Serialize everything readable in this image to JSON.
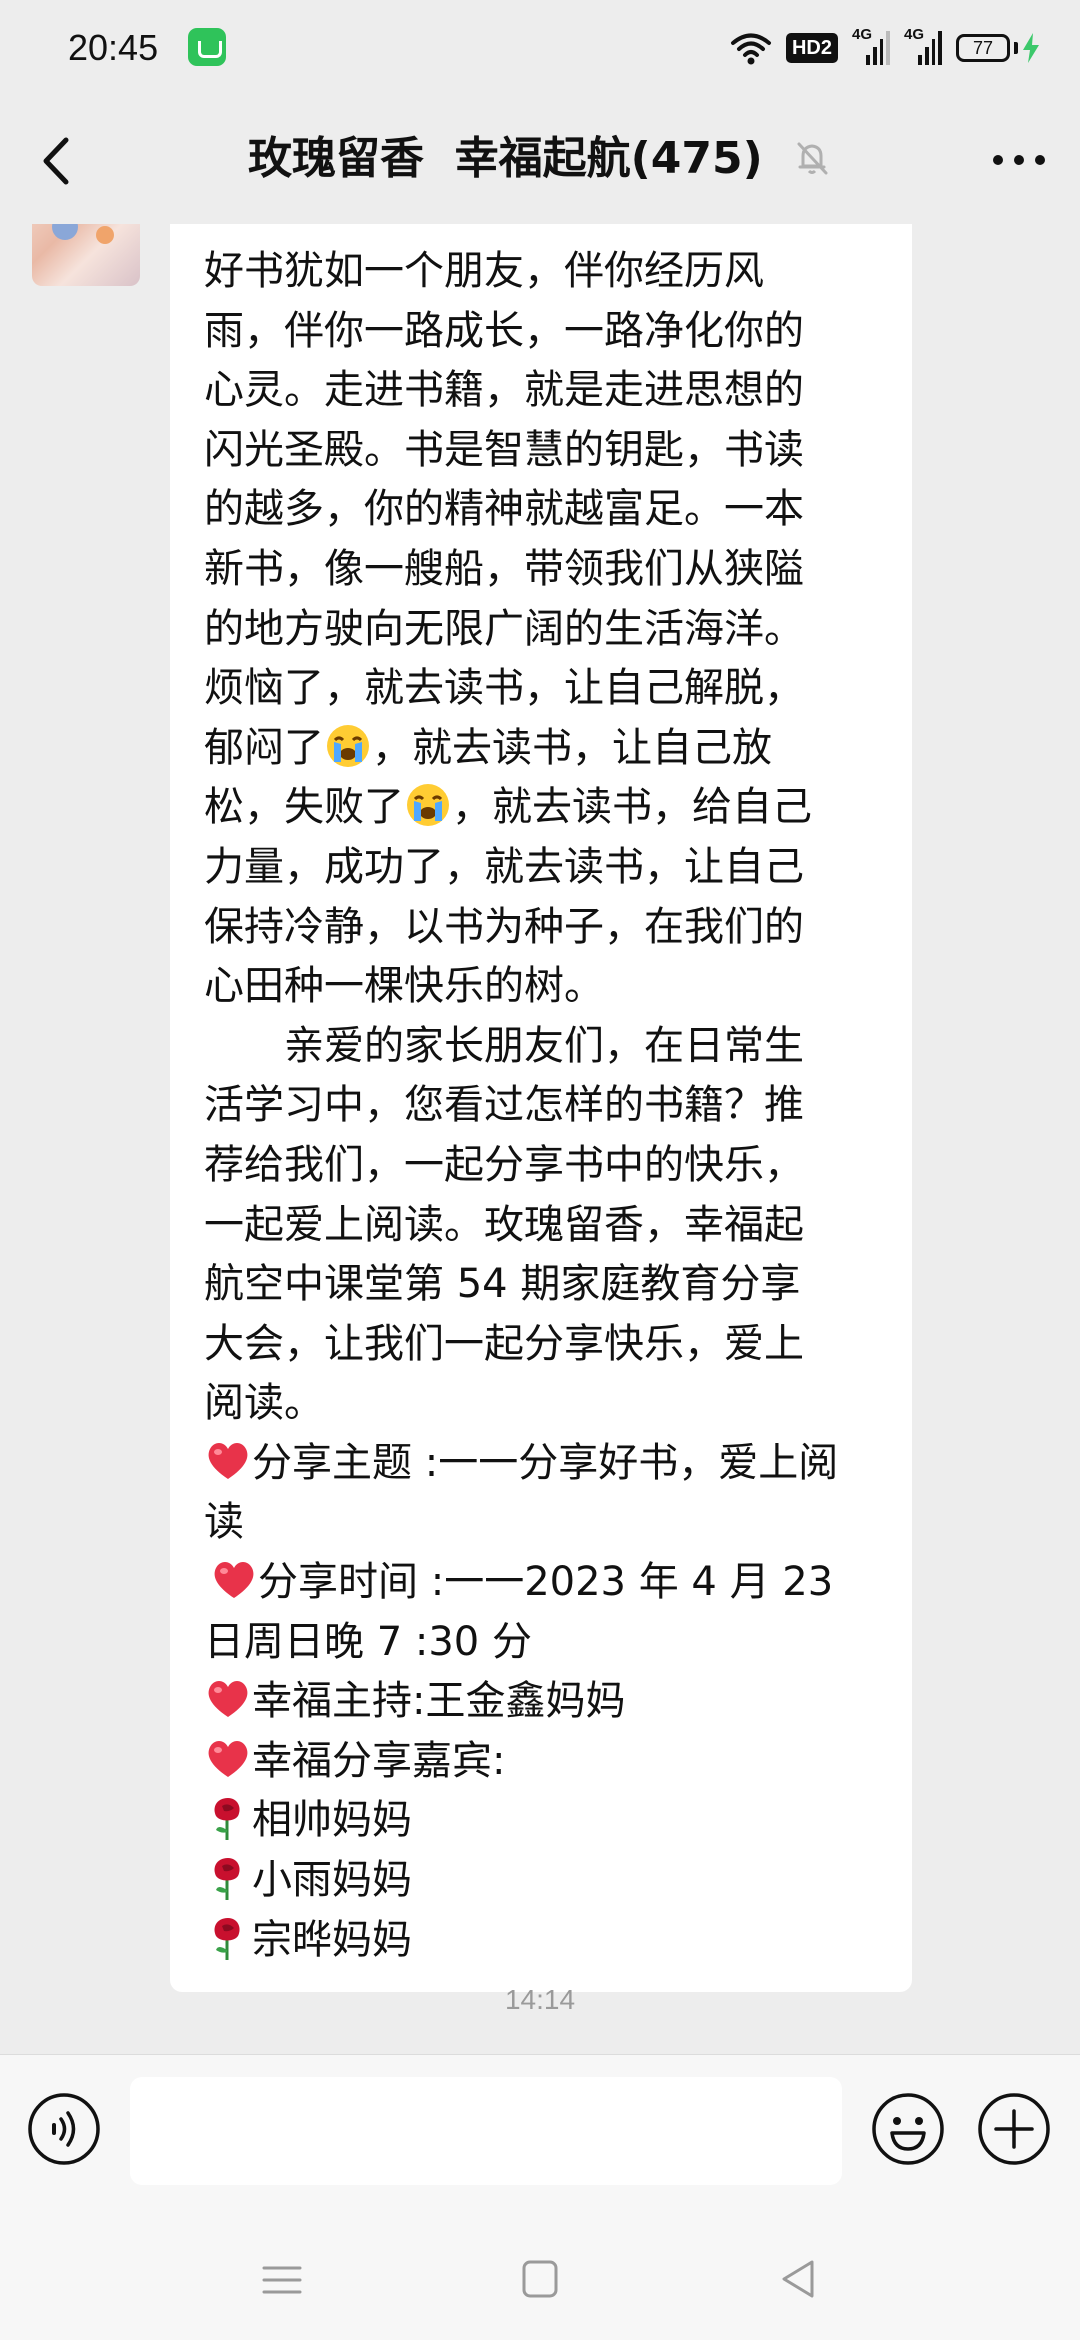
{
  "status_bar": {
    "time": "20:45",
    "hd": "HD2",
    "network_1": "4G",
    "network_2": "4G",
    "battery": "77"
  },
  "header": {
    "title": "玫瑰留香  幸福起航(475)",
    "icons": [
      "back-arrow-icon",
      "mute-bell-icon",
      "more-icon"
    ]
  },
  "message": {
    "lines": [
      "好书犹如一个朋友，伴你经历风",
      "雨，伴你一路成长，一路净化你的",
      "心灵。走进书籍，就是走进思想的",
      "闪光圣殿。书是智慧的钥匙，书读",
      "的越多，你的精神就越富足。一本",
      "新书，像一艘船，带领我们从狭隘",
      "的地方驶向无限广阔的生活海洋。",
      "烦恼了，就去读书，让自己解脱，"
    ],
    "line9_a": "郁闷了",
    "line9_b": "，就去读书，让自己放",
    "line10_a": "松，失败了",
    "line10_b": "，就去读书，给自己",
    "lines_b": [
      "力量，成功了，就去读书，让自己",
      "保持冷静，以书为种子，在我们的",
      "心田种一棵快乐的树。"
    ],
    "para2_first": "亲爱的家长朋友们，在日常生",
    "para2_lines": [
      "活学习中，您看过怎样的书籍？推",
      "荐给我们，一起分享书中的快乐，",
      "一起爱上阅读。玫瑰留香，幸福起",
      "航空中课堂第 54 期家庭教育分享",
      "大会，让我们一起分享快乐，爱上",
      "阅读。"
    ],
    "topic_line1": "分享主题 :一一分享好书，爱上阅",
    "topic_line2": "读",
    "time_line1": "分享时间 :一一2023 年 4 月 23",
    "time_line2": "日周日晚 7 :30 分",
    "host": "幸福主持:王金鑫妈妈",
    "guests_label": "幸福分享嘉宾:",
    "guests": [
      "相帅妈妈",
      "小雨妈妈",
      "宗晔妈妈"
    ],
    "emoji": {
      "cry": "crying-face-emoji",
      "heart": "red-heart-emoji",
      "rose": "rose-emoji"
    }
  },
  "timestamp": "14:14",
  "input_bar": {
    "placeholder": "",
    "value": ""
  },
  "colors": {
    "background": "#ededed",
    "bubble": "#ffffff",
    "heart": "#e8334a",
    "rose": "#c8102e",
    "charging": "#3cc86b",
    "app_badge": "#2fc35a"
  }
}
